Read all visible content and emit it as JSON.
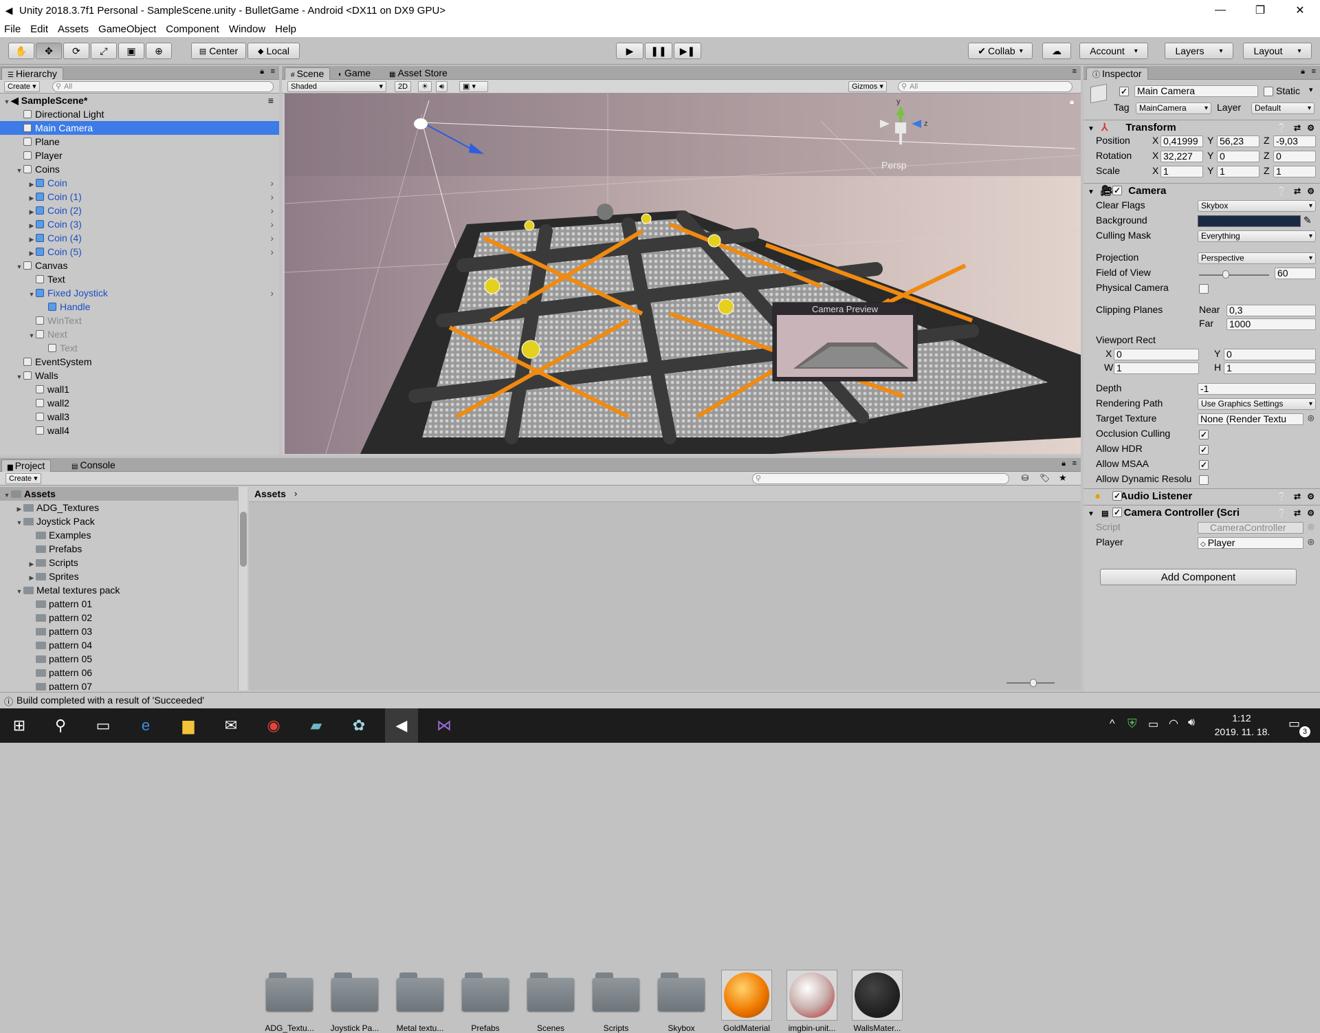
{
  "window": {
    "title": "Unity 2018.3.7f1 Personal - SampleScene.unity - BulletGame - Android <DX11 on DX9 GPU>"
  },
  "menu": [
    "File",
    "Edit",
    "Assets",
    "GameObject",
    "Component",
    "Window",
    "Help"
  ],
  "toolbar": {
    "center_label": "Center",
    "local_label": "Local",
    "collab_label": "Collab",
    "account_label": "Account",
    "layers_label": "Layers",
    "layout_label": "Layout"
  },
  "hierarchy": {
    "tab": "Hierarchy",
    "create": "Create",
    "search_placeholder": "All",
    "scene_name": "SampleScene*",
    "items": [
      {
        "label": "Directional Light",
        "indent": 1,
        "arrow": "",
        "style": ""
      },
      {
        "label": "Main Camera",
        "indent": 1,
        "arrow": "",
        "style": "sel"
      },
      {
        "label": "Plane",
        "indent": 1,
        "arrow": "",
        "style": ""
      },
      {
        "label": "Player",
        "indent": 1,
        "arrow": "",
        "style": ""
      },
      {
        "label": "Coins",
        "indent": 1,
        "arrow": "down",
        "style": ""
      },
      {
        "label": "Coin",
        "indent": 2,
        "arrow": "right",
        "style": "blue"
      },
      {
        "label": "Coin (1)",
        "indent": 2,
        "arrow": "right",
        "style": "blue"
      },
      {
        "label": "Coin (2)",
        "indent": 2,
        "arrow": "right",
        "style": "blue"
      },
      {
        "label": "Coin (3)",
        "indent": 2,
        "arrow": "right",
        "style": "blue"
      },
      {
        "label": "Coin (4)",
        "indent": 2,
        "arrow": "right",
        "style": "blue"
      },
      {
        "label": "Coin (5)",
        "indent": 2,
        "arrow": "right",
        "style": "blue"
      },
      {
        "label": "Canvas",
        "indent": 1,
        "arrow": "down",
        "style": ""
      },
      {
        "label": "Text",
        "indent": 2,
        "arrow": "",
        "style": ""
      },
      {
        "label": "Fixed Joystick",
        "indent": 2,
        "arrow": "down",
        "style": "blue"
      },
      {
        "label": "Handle",
        "indent": 3,
        "arrow": "",
        "style": "blue"
      },
      {
        "label": "WinText",
        "indent": 2,
        "arrow": "",
        "style": "dim"
      },
      {
        "label": "Next",
        "indent": 2,
        "arrow": "down",
        "style": "dim"
      },
      {
        "label": "Text",
        "indent": 3,
        "arrow": "",
        "style": "dim"
      },
      {
        "label": "EventSystem",
        "indent": 1,
        "arrow": "",
        "style": ""
      },
      {
        "label": "Walls",
        "indent": 1,
        "arrow": "down",
        "style": ""
      },
      {
        "label": "wall1",
        "indent": 2,
        "arrow": "",
        "style": ""
      },
      {
        "label": "wall2",
        "indent": 2,
        "arrow": "",
        "style": ""
      },
      {
        "label": "wall3",
        "indent": 2,
        "arrow": "",
        "style": ""
      },
      {
        "label": "wall4",
        "indent": 2,
        "arrow": "",
        "style": ""
      }
    ]
  },
  "scene": {
    "tabs": [
      "Scene",
      "Game",
      "Asset Store"
    ],
    "shading": "Shaded",
    "mode_2d": "2D",
    "gizmos": "Gizmos",
    "search_placeholder": "All",
    "persp_label": "Persp",
    "camera_preview_title": "Camera Preview"
  },
  "inspector": {
    "tab": "Inspector",
    "object_name": "Main Camera",
    "static_label": "Static",
    "tag_label": "Tag",
    "tag_value": "MainCamera",
    "layer_label": "Layer",
    "layer_value": "Default",
    "transform": {
      "title": "Transform",
      "position_label": "Position",
      "rotation_label": "Rotation",
      "scale_label": "Scale",
      "pos": {
        "x": "0,41999",
        "y": "56,23",
        "z": "-9,03"
      },
      "rot": {
        "x": "32,227",
        "y": "0",
        "z": "0"
      },
      "scale": {
        "x": "1",
        "y": "1",
        "z": "1"
      }
    },
    "camera": {
      "title": "Camera",
      "clear_flags_label": "Clear Flags",
      "clear_flags": "Skybox",
      "background_label": "Background",
      "background_color": "#1b2a44",
      "culling_mask_label": "Culling Mask",
      "culling_mask": "Everything",
      "projection_label": "Projection",
      "projection": "Perspective",
      "fov_label": "Field of View",
      "fov": "60",
      "fov_slider_fraction": 0.35,
      "physical_label": "Physical Camera",
      "clipping_label": "Clipping Planes",
      "near_label": "Near",
      "near": "0,3",
      "far_label": "Far",
      "far": "1000",
      "viewport_label": "Viewport Rect",
      "vp": {
        "x": "0",
        "y": "0",
        "w": "1",
        "h": "1"
      },
      "depth_label": "Depth",
      "depth": "-1",
      "rendering_path_label": "Rendering Path",
      "rendering_path": "Use Graphics Settings",
      "target_texture_label": "Target Texture",
      "target_texture": "None (Render Textu",
      "occlusion_label": "Occlusion Culling",
      "hdr_label": "Allow HDR",
      "msaa_label": "Allow MSAA",
      "dynamic_label": "Allow Dynamic Resolu"
    },
    "audio_listener": "Audio Listener",
    "camera_controller": {
      "title": "Camera Controller (Scri",
      "script_label": "Script",
      "script_value": "CameraController",
      "player_label": "Player",
      "player_value": "Player"
    },
    "add_component": "Add Component"
  },
  "project": {
    "tabs": [
      "Project",
      "Console"
    ],
    "create": "Create",
    "breadcrumb": "Assets",
    "tree": [
      {
        "label": "Assets",
        "indent": 0,
        "arrow": "down",
        "bold": true
      },
      {
        "label": "ADG_Textures",
        "indent": 1,
        "arrow": "right"
      },
      {
        "label": "Joystick Pack",
        "indent": 1,
        "arrow": "down"
      },
      {
        "label": "Examples",
        "indent": 2,
        "arrow": ""
      },
      {
        "label": "Prefabs",
        "indent": 2,
        "arrow": ""
      },
      {
        "label": "Scripts",
        "indent": 2,
        "arrow": "right"
      },
      {
        "label": "Sprites",
        "indent": 2,
        "arrow": "right"
      },
      {
        "label": "Metal textures pack",
        "indent": 1,
        "arrow": "down"
      },
      {
        "label": "pattern 01",
        "indent": 2,
        "arrow": ""
      },
      {
        "label": "pattern 02",
        "indent": 2,
        "arrow": ""
      },
      {
        "label": "pattern 03",
        "indent": 2,
        "arrow": ""
      },
      {
        "label": "pattern 04",
        "indent": 2,
        "arrow": ""
      },
      {
        "label": "pattern 05",
        "indent": 2,
        "arrow": ""
      },
      {
        "label": "pattern 06",
        "indent": 2,
        "arrow": ""
      },
      {
        "label": "pattern 07",
        "indent": 2,
        "arrow": ""
      }
    ],
    "assets": [
      {
        "label": "ADG_Textu...",
        "kind": "folder"
      },
      {
        "label": "Joystick Pa...",
        "kind": "folder"
      },
      {
        "label": "Metal textu...",
        "kind": "folder"
      },
      {
        "label": "Prefabs",
        "kind": "folder"
      },
      {
        "label": "Scenes",
        "kind": "folder"
      },
      {
        "label": "Scripts",
        "kind": "folder"
      },
      {
        "label": "Skybox",
        "kind": "folder"
      },
      {
        "label": "GoldMaterial",
        "kind": "gold"
      },
      {
        "label": "imgbin-unit...",
        "kind": "unity"
      },
      {
        "label": "WallsMater...",
        "kind": "dark"
      }
    ]
  },
  "status": {
    "message": "Build completed with a result of 'Succeeded'"
  },
  "taskbar": {
    "time": "1:12",
    "date": "2019. 11. 18.",
    "notification_count": "3"
  }
}
